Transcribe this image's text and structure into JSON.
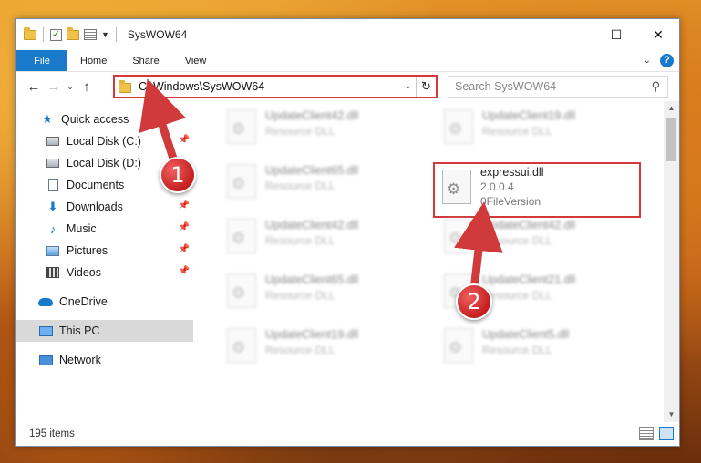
{
  "window": {
    "title": "SysWOW64",
    "buttons": {
      "minimize": "—",
      "maximize": "☐",
      "close": "✕"
    }
  },
  "ribbon": {
    "tabs": [
      "File",
      "Home",
      "Share",
      "View"
    ],
    "help": "?"
  },
  "address": {
    "path": "C:\\Windows\\SysWOW64",
    "search_placeholder": "Search SysWOW64"
  },
  "sidebar": {
    "items": [
      {
        "label": "Quick access",
        "icon": "star-icon",
        "pinned": false
      },
      {
        "label": "Local Disk (C:)",
        "icon": "disk-icon",
        "pinned": true
      },
      {
        "label": "Local Disk (D:)",
        "icon": "disk-icon",
        "pinned": false
      },
      {
        "label": "Documents",
        "icon": "documents-icon",
        "pinned": false
      },
      {
        "label": "Downloads",
        "icon": "downloads-icon",
        "pinned": true
      },
      {
        "label": "Music",
        "icon": "music-icon",
        "pinned": true
      },
      {
        "label": "Pictures",
        "icon": "pictures-icon",
        "pinned": true
      },
      {
        "label": "Videos",
        "icon": "videos-icon",
        "pinned": true
      },
      {
        "label": "OneDrive",
        "icon": "onedrive-icon",
        "pinned": false
      },
      {
        "label": "This PC",
        "icon": "this-pc-icon",
        "pinned": false,
        "selected": true
      },
      {
        "label": "Network",
        "icon": "network-icon",
        "pinned": false
      }
    ]
  },
  "files": {
    "left": [
      {
        "name": "UpdateClient42.dll",
        "type": "Resource DLL"
      },
      {
        "name": "UpdateClient65.dll",
        "type": "Resource DLL"
      },
      {
        "name": "UpdateClient42.dll",
        "type": "Resource DLL"
      },
      {
        "name": "UpdateClient65.dll",
        "type": "Resource DLL"
      },
      {
        "name": "UpdateClient19.dll",
        "type": "Resource DLL"
      }
    ],
    "right": [
      {
        "name": "UpdateClient19.dll",
        "type": "Resource DLL"
      },
      {
        "name": "expressui.dll",
        "version": "2.0.0.4",
        "type": "0FileVersion",
        "highlighted": true
      },
      {
        "name": "UpdateClient42.dll",
        "type": "Resource DLL"
      },
      {
        "name": "UpdateClient21.dll",
        "type": "Resource DLL"
      },
      {
        "name": "UpdateClient5.dll",
        "type": "Resource DLL"
      }
    ]
  },
  "status": {
    "count": "195 items"
  },
  "annotations": {
    "step1": "1",
    "step2": "2",
    "color": "#d03a3a"
  }
}
